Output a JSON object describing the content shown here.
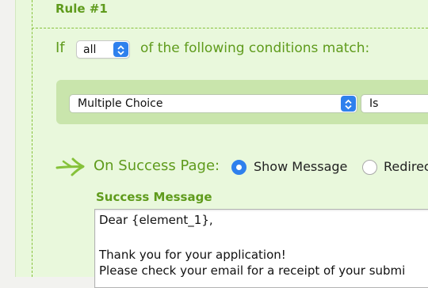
{
  "rule": {
    "title": "Rule #1"
  },
  "condition": {
    "if_label": "If",
    "match_value": "all",
    "suffix": "of the following conditions match:",
    "field_value": "Multiple Choice",
    "operator_value": "Is"
  },
  "success": {
    "label": "On Success Page:",
    "options": [
      "Show Message",
      "Redirect"
    ],
    "selected": "Show Message",
    "message_label": "Success Message",
    "message_lines": [
      "Dear {element_1},",
      "",
      "Thank you for your application!",
      "Please check your email for a receipt of your submi"
    ]
  },
  "colors": {
    "accent_green": "#5f9b1c",
    "panel_bg": "#e9f8dc",
    "condition_bg": "#c9e5ac",
    "select_blue": "#2f80ed"
  },
  "icons": {
    "success_arrow": "arrow-right-icon",
    "select_arrows": "chevron-updown-icon"
  }
}
